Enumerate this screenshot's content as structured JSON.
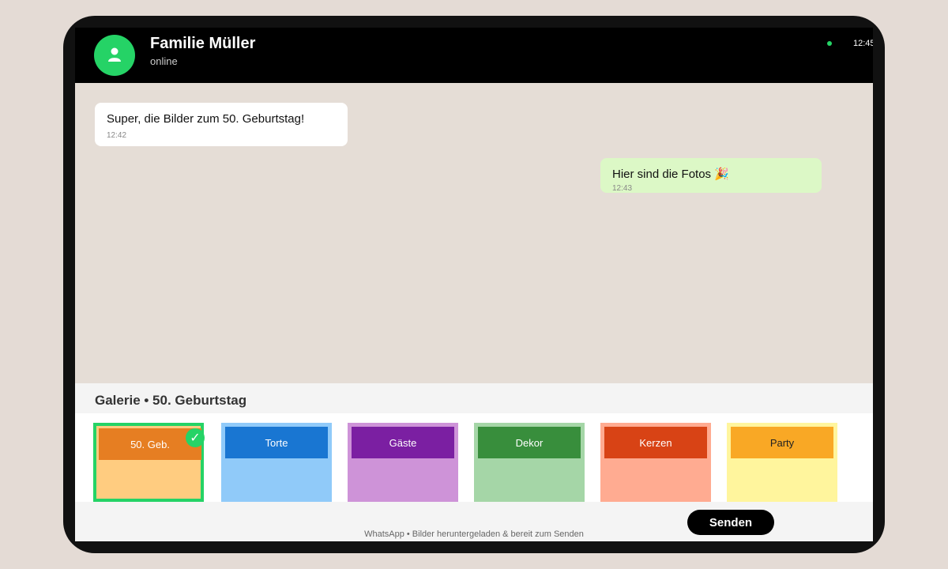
{
  "header": {
    "contact_name": "Familie Müller",
    "status": "online",
    "time": "12:45",
    "avatar_icon": "user-icon"
  },
  "messages": [
    {
      "direction": "incoming",
      "text": "Super, die Bilder zum 50. Geburtstag!",
      "time": "12:42"
    },
    {
      "direction": "outgoing",
      "text": "Hier sind die Fotos 🎉",
      "time": "12:43"
    }
  ],
  "gallery": {
    "title": "Galerie • 50. Geburtstag",
    "items": [
      {
        "label": "50. Geb.",
        "selected": true,
        "label_bg": "#e67e22",
        "tile_bg": "#ffcc80",
        "text_color": "#ffffff"
      },
      {
        "label": "Torte",
        "selected": false,
        "label_bg": "#1976d2",
        "tile_bg": "#90caf9",
        "text_color": "#ffffff"
      },
      {
        "label": "Gäste",
        "selected": false,
        "label_bg": "#7b1fa2",
        "tile_bg": "#ce93d8",
        "text_color": "#ffffff"
      },
      {
        "label": "Dekor",
        "selected": false,
        "label_bg": "#388e3c",
        "tile_bg": "#a5d6a7",
        "text_color": "#ffffff"
      },
      {
        "label": "Kerzen",
        "selected": false,
        "label_bg": "#d84315",
        "tile_bg": "#ffab91",
        "text_color": "#ffffff"
      },
      {
        "label": "Party",
        "selected": false,
        "label_bg": "#f9a825",
        "tile_bg": "#fff59d",
        "text_color": "#222222"
      }
    ],
    "check_icon": "✓"
  },
  "footer": {
    "note": "WhatsApp • Bilder heruntergeladen & bereit zum Senden",
    "send_label": "Senden"
  },
  "colors": {
    "accent": "#25d366",
    "outgoing_bubble": "#dcf8c6",
    "incoming_bubble": "#ffffff",
    "chat_bg": "#e5ddd6"
  }
}
